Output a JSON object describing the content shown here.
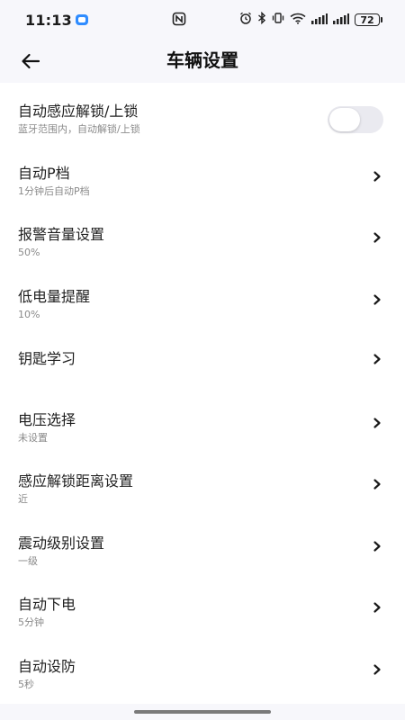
{
  "status_bar": {
    "time": "11:13",
    "battery": "72"
  },
  "header": {
    "title": "车辆设置"
  },
  "settings": [
    {
      "title": "自动感应解锁/上锁",
      "subtitle": "蓝牙范围内，自动解锁/上锁",
      "control": "toggle",
      "enabled": false
    },
    {
      "title": "自动P档",
      "subtitle": "1分钟后自动P档",
      "control": "chevron"
    },
    {
      "title": "报警音量设置",
      "subtitle": "50%",
      "control": "chevron"
    },
    {
      "title": "低电量提醒",
      "subtitle": "10%",
      "control": "chevron"
    },
    {
      "title": "钥匙学习",
      "subtitle": "",
      "control": "chevron"
    },
    {
      "title": "电压选择",
      "subtitle": "未设置",
      "control": "chevron"
    },
    {
      "title": "感应解锁距离设置",
      "subtitle": "近",
      "control": "chevron"
    },
    {
      "title": "震动级别设置",
      "subtitle": "一级",
      "control": "chevron"
    },
    {
      "title": "自动下电",
      "subtitle": "5分钟",
      "control": "chevron"
    },
    {
      "title": "自动设防",
      "subtitle": "5秒",
      "control": "chevron"
    }
  ],
  "colors": {
    "page_background": "#f7f7fb",
    "list_background": "#ffffff",
    "toggle_off": "#eaeaf0",
    "subtitle_text": "#8a8a8a"
  }
}
